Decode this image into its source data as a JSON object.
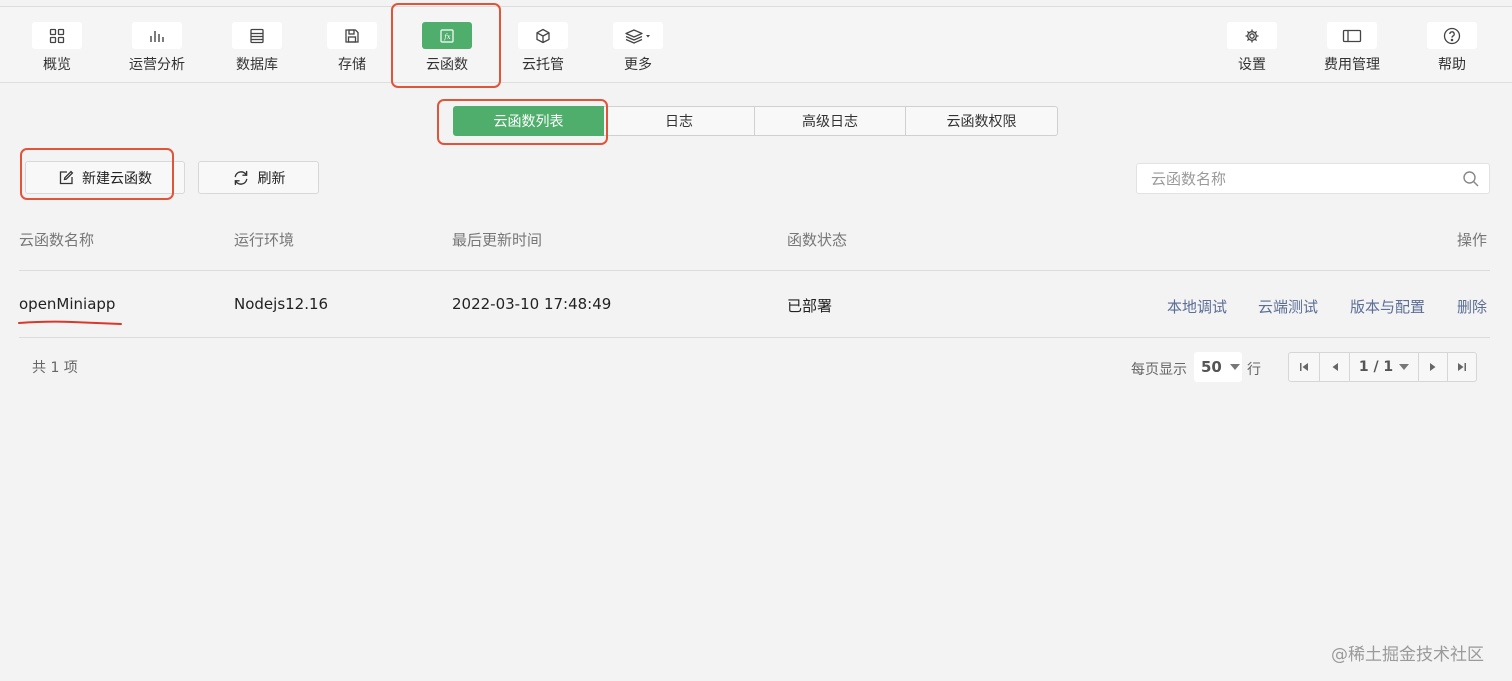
{
  "nav": {
    "items": [
      {
        "label": "概览",
        "icon": "grid-icon"
      },
      {
        "label": "运营分析",
        "icon": "bar-chart-icon"
      },
      {
        "label": "数据库",
        "icon": "database-icon"
      },
      {
        "label": "存储",
        "icon": "save-disk-icon"
      },
      {
        "label": "云函数",
        "icon": "function-icon",
        "active": true
      },
      {
        "label": "云托管",
        "icon": "cube-icon"
      },
      {
        "label": "更多",
        "icon": "layers-icon"
      },
      {
        "label": "设置",
        "icon": "gear-icon"
      },
      {
        "label": "费用管理",
        "icon": "card-icon"
      },
      {
        "label": "帮助",
        "icon": "help-icon"
      }
    ]
  },
  "tabs": [
    {
      "label": "云函数列表",
      "active": true
    },
    {
      "label": "日志"
    },
    {
      "label": "高级日志"
    },
    {
      "label": "云函数权限"
    }
  ],
  "toolbar": {
    "new_label": "新建云函数",
    "refresh_label": "刷新",
    "search_placeholder": "云函数名称"
  },
  "table": {
    "headers": {
      "name": "云函数名称",
      "runtime": "运行环境",
      "updated": "最后更新时间",
      "status": "函数状态",
      "ops": "操作"
    },
    "rows": [
      {
        "name": "openMiniapp",
        "runtime": "Nodejs12.16",
        "updated": "2022-03-10 17:48:49",
        "status": "已部署",
        "actions": [
          "本地调试",
          "云端测试",
          "版本与配置",
          "删除"
        ]
      }
    ]
  },
  "footer": {
    "total": "共 1 项",
    "per_page_label": "每页显示",
    "per_page_value": "50",
    "row_unit": "行",
    "page_indicator": "1 / 1"
  },
  "watermark": "@稀土掘金技术社区",
  "colors": {
    "accent_green": "#4fae6c",
    "highlight_red": "#e0553a",
    "link_blue": "#5b6e96"
  }
}
